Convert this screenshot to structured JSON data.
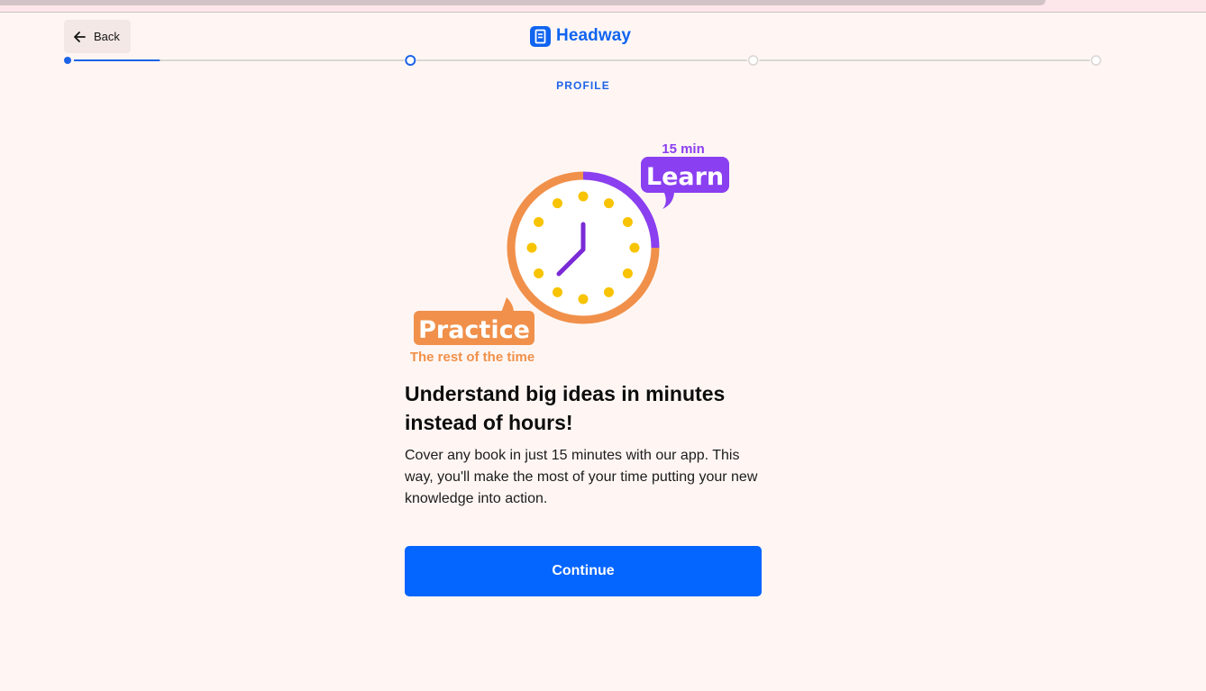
{
  "header": {
    "back_label": "Back",
    "logo_text": "Headway"
  },
  "progress": {
    "step_label": "PROFILE",
    "total_steps": 4,
    "current_step": 2,
    "segment_fill": 0.26,
    "active_color": "#1d63e8",
    "inactive_color": "#d9d6d4"
  },
  "illustration": {
    "learn_duration": "15 min",
    "learn_label": "Learn",
    "practice_label": "Practice",
    "practice_sub": "The rest of the time",
    "learn_color": "#8a3ff0",
    "practice_color": "#f0904a",
    "dot_color": "#f8c300",
    "hands_color": "#7a2ad6"
  },
  "main": {
    "headline": "Understand big ideas in minutes instead of hours!",
    "body": "Cover any book in just 15 minutes with our app. This way, you'll make the most of your time putting your new knowledge into action.",
    "cta_label": "Continue"
  },
  "colors": {
    "background": "#fff6f3",
    "primary": "#0565ff"
  }
}
